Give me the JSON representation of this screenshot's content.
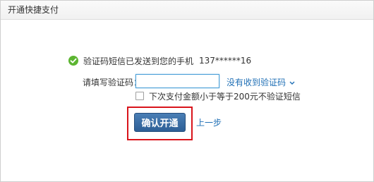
{
  "window": {
    "title": "开通快捷支付"
  },
  "status": {
    "icon": "check-circle-icon",
    "icon_color": "#5cb531",
    "message": "验证码短信已发送到您的手机",
    "phone": "137******16"
  },
  "form": {
    "code_label": "请填写验证码：",
    "code_value": "",
    "resend_link": "没有收到验证码",
    "resend_icon": "chevron-down-icon",
    "checkbox_checked": false,
    "checkbox_label": "下次支付金额小于等于200元不验证短信"
  },
  "actions": {
    "confirm_label": "确认开通",
    "back_label": "上一步",
    "highlight_color": "#d9141b",
    "link_color": "#1f6fb5"
  }
}
